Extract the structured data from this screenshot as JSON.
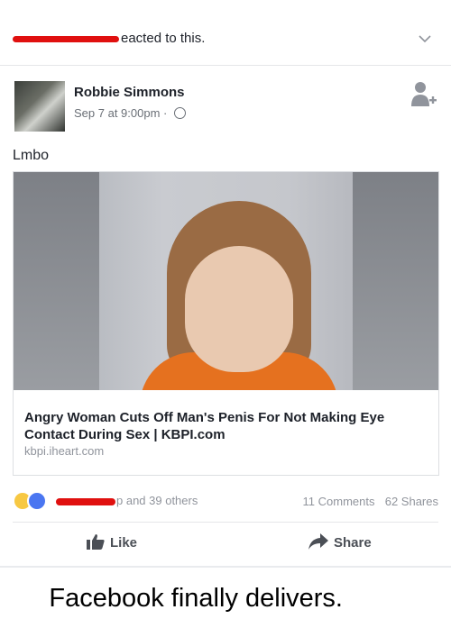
{
  "notification": {
    "text": "eacted to this."
  },
  "post": {
    "author": "Robbie Simmons",
    "time": "Sep 7 at 9:00pm",
    "separator": "·",
    "text": "Lmbo"
  },
  "link": {
    "headline": "Angry Woman Cuts Off Man's Penis For Not Making Eye Contact During Sex | KBPI.com",
    "domain": "kbpi.iheart.com"
  },
  "engagement": {
    "reaction_names": "p and 39 others",
    "comments": "11 Comments",
    "shares": "62 Shares"
  },
  "actions": {
    "like": "Like",
    "share": "Share"
  },
  "caption": "Facebook finally delivers.",
  "icons": [
    "chevron-down-icon",
    "globe-icon",
    "add-friend-icon",
    "haha-reaction-icon",
    "like-reaction-icon",
    "thumbs-up-icon",
    "share-arrow-icon"
  ]
}
